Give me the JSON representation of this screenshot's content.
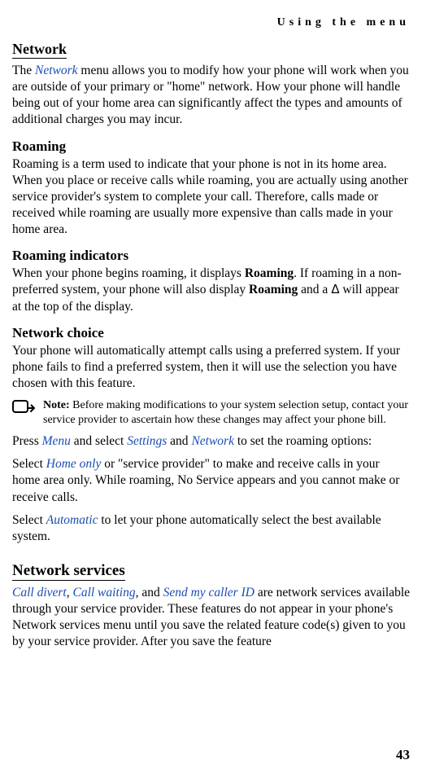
{
  "runningHeader": "Using the menu",
  "pageNumber": "43",
  "section1": {
    "heading": "Network",
    "intro_pre": "The ",
    "intro_link": "Network",
    "intro_post": " menu allows you to modify how your phone will work when you are outside of your primary or \"home\" network. How your phone will handle being out of your home area can significantly affect the types and amounts of additional charges you may incur."
  },
  "roaming": {
    "heading": "Roaming",
    "body": "Roaming is a term used to indicate that your phone is not in its home area. When you place or receive calls while roaming, you are actually using another service provider's system to complete your call. Therefore, calls made or received while roaming are usually more expensive than calls made in your home area."
  },
  "roamingIndicators": {
    "heading": "Roaming indicators",
    "part1": "When your phone begins roaming, it displays ",
    "bold1": "Roaming",
    "part2": ". If roaming in a non-preferred system, your phone will also display ",
    "bold2": "Roaming",
    "part3": " and a ",
    "triangle": "Δ",
    "part4": " will appear at the top of the display."
  },
  "networkChoice": {
    "heading": "Network choice",
    "body": "Your phone will automatically attempt calls using a preferred system. If your phone fails to find a preferred system, then it will use the selection you have chosen with this feature.",
    "note_label": "Note:",
    "note_text": " Before making modifications to your system selection setup, contact your service provider to ascertain how these changes may affect your phone bill.",
    "press_pre": "Press ",
    "press_menu": "Menu",
    "press_mid1": " and select ",
    "press_settings": "Settings",
    "press_mid2": " and ",
    "press_network": "Network",
    "press_post": " to set the roaming options:",
    "select1_pre": "Select ",
    "select1_link": "Home only",
    "select1_post": " or \"service provider\" to make and receive calls in your home area only. While roaming, No Service appears and you cannot make or receive calls.",
    "select2_pre": "Select ",
    "select2_link": "Automatic",
    "select2_post": " to let your phone automatically select the best available system."
  },
  "networkServices": {
    "heading": "Network services",
    "link1": "Call divert",
    "sep1": ", ",
    "link2": "Call waiting",
    "sep2": ", and ",
    "link3": "Send my caller ID",
    "body_post": " are network services available through your service provider. These features do not appear in your phone's Network services menu until you save the related feature code(s) given to you by your service provider. After you save the feature"
  }
}
